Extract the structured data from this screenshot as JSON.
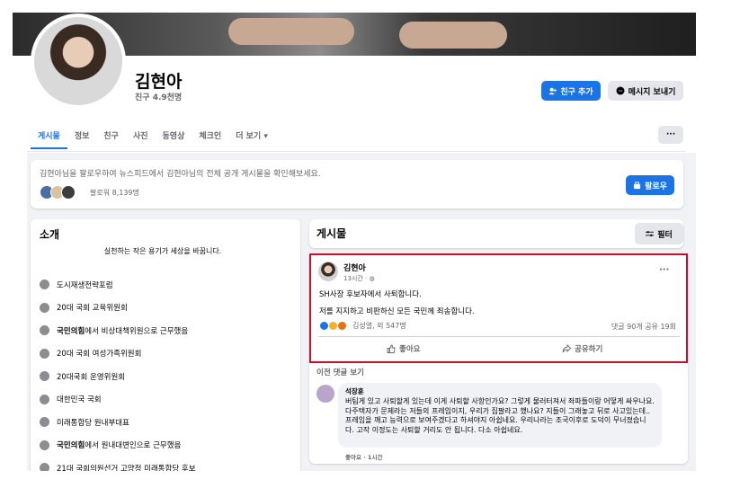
{
  "profile": {
    "name": "김현아",
    "friends": "친구 4.9천명",
    "add_friend_label": "친구 추가",
    "message_label": "메시지 보내기"
  },
  "tabs": [
    {
      "label": "게시물",
      "active": true
    },
    {
      "label": "정보"
    },
    {
      "label": "친구"
    },
    {
      "label": "사진"
    },
    {
      "label": "동영상"
    },
    {
      "label": "체크인"
    },
    {
      "label": "더 보기"
    }
  ],
  "more_tab_dropdown": "▾",
  "follow_bar": {
    "text": "김현아님을 팔로우하여 뉴스피드에서 김현아님의 전체 공개 게시물을 확인해보세요.",
    "followers": "팔로워 8,139명",
    "follow_label": "팔로우"
  },
  "intro": {
    "title": "소개",
    "motto": "실천하는 작은 용기가 세상을 바꿉니다.",
    "items": [
      {
        "label": "도시재생전략포럼"
      },
      {
        "label": "20대 국회 교육위원회"
      },
      {
        "bold": "국민의힘",
        "label": "에서 비상대책위원으로 근무했음"
      },
      {
        "label": "20대 국회 여성가족위원회"
      },
      {
        "label": "20대국회 운영위원회"
      },
      {
        "label": "대한민국 국회"
      },
      {
        "label": "미래통합당 원내부대표"
      },
      {
        "bold": "국민의힘",
        "label": "에서 원내대변인으로 근무했음"
      },
      {
        "label": "21대 국회의원선거 고양정 미래통합당 후보"
      }
    ]
  },
  "posts": {
    "title": "게시물",
    "filter_label": "필터",
    "post": {
      "author": "김현아",
      "time": "13시간 · ",
      "more": "···",
      "line1": "SH사장 후보자에서 사퇴합니다.",
      "line2": "저를 지지하고 비판하신 모든 국민께 죄송합니다.",
      "reactions": "김성열, 외 547명",
      "stats": "댓글 90개  공유 19회",
      "like_label": "좋아요",
      "share_label": "공유하기"
    },
    "prev_comments": "이전 댓글 보기",
    "comment": {
      "author": "석장훈",
      "text": "버팀게 있고 사퇴할게 있는데 이게 사퇴할 사항인가요? 그렇게 물러터져서 좌파들이랑 어떻게 싸우나요. 다주택자가 문제라는 저들의 프레임이지, 우리가 집팔라고 했나요? 지들이 그래놓고 뒤로 사고있는데.. 프레임을 깨고 능력으로 보여주겠다고 하셔야지 아쉽네요. 우리나라는 조국이후로 도덕이 무너졌습니다. 고작 이정도는 사퇴할 거리도 안 됩니다. 다소 아쉽네요.",
      "meta": "좋아요 · 1시간"
    }
  },
  "colors": {
    "accent": "#1b74e4",
    "highlight_box": "#c8102e",
    "background": "#f0f2f5"
  }
}
